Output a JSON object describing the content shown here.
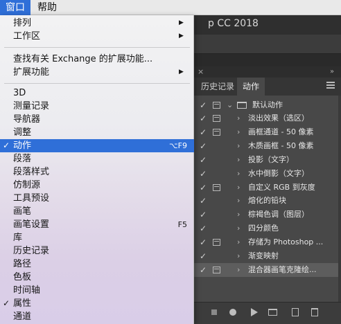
{
  "menubar": {
    "window_label": "窗口",
    "help_label": "帮助"
  },
  "app_title": "p CC 2018",
  "menu": {
    "group1": [
      {
        "label": "排列",
        "submenu": true
      },
      {
        "label": "工作区",
        "submenu": true
      }
    ],
    "group2": [
      {
        "label": "查找有关 Exchange 的扩展功能...",
        "submenu": false
      },
      {
        "label": "扩展功能",
        "submenu": true
      }
    ],
    "group3": [
      {
        "label": "3D",
        "checked": false,
        "shortcut": ""
      },
      {
        "label": "测量记录",
        "checked": false,
        "shortcut": ""
      },
      {
        "label": "导航器",
        "checked": false,
        "shortcut": ""
      },
      {
        "label": "调整",
        "checked": false,
        "shortcut": ""
      },
      {
        "label": "动作",
        "checked": true,
        "shortcut": "⌥F9",
        "highlighted": true
      },
      {
        "label": "段落",
        "checked": false,
        "shortcut": ""
      },
      {
        "label": "段落样式",
        "checked": false,
        "shortcut": ""
      },
      {
        "label": "仿制源",
        "checked": false,
        "shortcut": ""
      },
      {
        "label": "工具预设",
        "checked": false,
        "shortcut": ""
      },
      {
        "label": "画笔",
        "checked": false,
        "shortcut": ""
      },
      {
        "label": "画笔设置",
        "checked": false,
        "shortcut": "F5"
      },
      {
        "label": "库",
        "checked": false,
        "shortcut": ""
      },
      {
        "label": "历史记录",
        "checked": false,
        "shortcut": ""
      },
      {
        "label": "路径",
        "checked": false,
        "shortcut": ""
      },
      {
        "label": "色板",
        "checked": false,
        "shortcut": ""
      },
      {
        "label": "时间轴",
        "checked": false,
        "shortcut": ""
      },
      {
        "label": "属性",
        "checked": true,
        "shortcut": ""
      },
      {
        "label": "通道",
        "checked": false,
        "shortcut": ""
      }
    ],
    "check_glyph": "✓",
    "arrow_glyph": "▶"
  },
  "panel": {
    "close_glyph": "×",
    "collapse_glyph": "»",
    "tabs": [
      "历史记录",
      "动作"
    ],
    "active_tab": 1,
    "set": {
      "label": "默认动作",
      "checked": true,
      "dialog": true
    },
    "actions": [
      {
        "label": "淡出效果（选区）",
        "checked": true,
        "dialog": true
      },
      {
        "label": "画框通道 - 50 像素",
        "checked": true,
        "dialog": true
      },
      {
        "label": "木质画框 - 50 像素",
        "checked": true,
        "dialog": false
      },
      {
        "label": "投影（文字）",
        "checked": true,
        "dialog": false
      },
      {
        "label": "水中倒影（文字）",
        "checked": true,
        "dialog": false
      },
      {
        "label": "自定义 RGB 到灰度",
        "checked": true,
        "dialog": true
      },
      {
        "label": "熔化的铅块",
        "checked": true,
        "dialog": false
      },
      {
        "label": "棕褐色调（图层）",
        "checked": true,
        "dialog": false
      },
      {
        "label": "四分颜色",
        "checked": true,
        "dialog": false
      },
      {
        "label": "存储为 Photoshop ...",
        "checked": true,
        "dialog": true
      },
      {
        "label": "渐变映射",
        "checked": true,
        "dialog": false
      },
      {
        "label": "混合器画笔克隆绘...",
        "checked": true,
        "dialog": true,
        "selected": true
      }
    ],
    "footer_icons": [
      "stop-icon",
      "record-icon",
      "play-icon",
      "new-set-icon",
      "new-action-icon",
      "trash-icon"
    ]
  },
  "colors": {
    "menu_highlight": "#2f6fd8",
    "panel_bg": "#484848"
  }
}
